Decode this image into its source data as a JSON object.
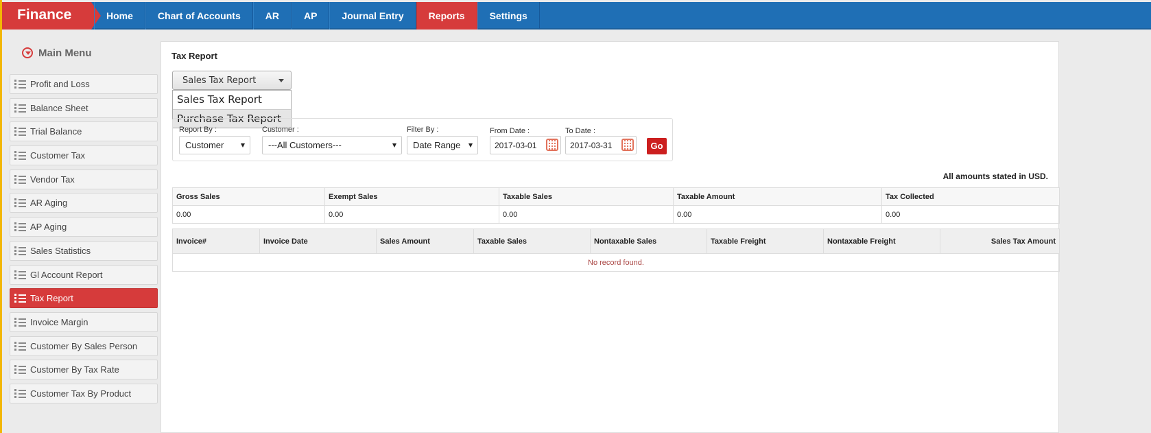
{
  "app": {
    "brand": "Finance"
  },
  "nav": {
    "items": [
      {
        "label": "Home"
      },
      {
        "label": "Chart of Accounts"
      },
      {
        "label": "AR"
      },
      {
        "label": "AP"
      },
      {
        "label": "Journal Entry"
      },
      {
        "label": "Reports",
        "active": true
      },
      {
        "label": "Settings"
      }
    ]
  },
  "sidebar": {
    "heading": "Main Menu",
    "items": [
      {
        "label": "Profit and Loss"
      },
      {
        "label": "Balance Sheet"
      },
      {
        "label": "Trial Balance"
      },
      {
        "label": "Customer Tax"
      },
      {
        "label": "Vendor Tax"
      },
      {
        "label": "AR Aging"
      },
      {
        "label": "AP Aging"
      },
      {
        "label": "Sales Statistics"
      },
      {
        "label": "Gl Account Report"
      },
      {
        "label": "Tax Report",
        "active": true
      },
      {
        "label": "Invoice Margin"
      },
      {
        "label": "Customer By Sales Person"
      },
      {
        "label": "Customer By Tax Rate"
      },
      {
        "label": "Customer Tax By Product"
      }
    ]
  },
  "main": {
    "title": "Tax Report",
    "report_type": {
      "selected": "Sales Tax Report",
      "options": [
        "Sales Tax Report",
        "Purchase Tax Report"
      ],
      "highlighted_option": "Purchase Tax Report"
    },
    "filters": {
      "report_by_label": "Report By :",
      "report_by_value": "Customer",
      "customer_label": "Customer :",
      "customer_value": "---All Customers---",
      "filter_by_label": "Filter By :",
      "filter_by_value": "Date Range",
      "from_date_label": "From Date :",
      "from_date_value": "2017-03-01",
      "to_date_label": "To Date :",
      "to_date_value": "2017-03-31",
      "go_label": "Go"
    },
    "currency_note": "All amounts stated in USD.",
    "summary": {
      "headers": [
        "Gross Sales",
        "Exempt Sales",
        "Taxable Sales",
        "Taxable Amount",
        "Tax Collected"
      ],
      "values": [
        "0.00",
        "0.00",
        "0.00",
        "0.00",
        "0.00"
      ]
    },
    "detail": {
      "headers": [
        "Invoice#",
        "Invoice Date",
        "Sales Amount",
        "Taxable Sales",
        "Nontaxable Sales",
        "Taxable Freight",
        "Nontaxable Freight",
        "Sales Tax Amount"
      ],
      "empty_message": "No record found."
    }
  },
  "colors": {
    "nav_blue": "#1f6fb5",
    "accent_red": "#d63b3b",
    "edge_yellow": "#f2b705"
  }
}
